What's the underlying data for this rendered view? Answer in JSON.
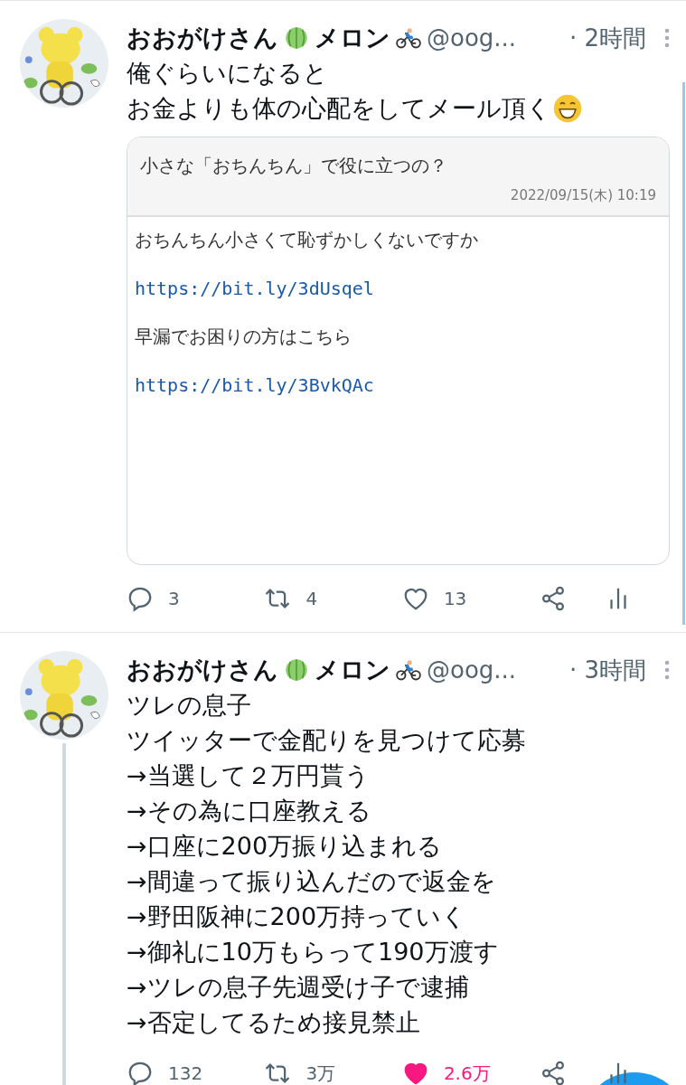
{
  "tweets": [
    {
      "name": [
        "おおがけさん",
        "メロン"
      ],
      "handle": "@oog...",
      "time": "· 2時間",
      "thread": false,
      "body": [
        {
          "kind": "plain",
          "text": "俺ぐらいになると"
        },
        {
          "kind": "grin",
          "text": "お金よりも体の心配をしてメール頂く"
        }
      ],
      "card": {
        "title": "小さな「おちんちん」で役に立つの？",
        "date": "2022/09/15(木) 10:19",
        "lines": [
          {
            "kind": "text",
            "text": "おちんちん小さくて恥ずかしくないですか"
          },
          {
            "kind": "link",
            "text": "https://bit.ly/3dUsqel"
          },
          {
            "kind": "text",
            "text": "早漏でお困りの方はこちら"
          },
          {
            "kind": "link",
            "text": "https://bit.ly/3BvkQAc"
          }
        ]
      },
      "replies": "3",
      "retweets": "4",
      "likes": "13",
      "liked": false
    },
    {
      "name": [
        "おおがけさん",
        "メロン"
      ],
      "handle": "@oog...",
      "time": "· 3時間",
      "thread": true,
      "body": [
        {
          "text": "ツレの息子"
        },
        {
          "text": "ツイッターで金配りを見つけて応募"
        },
        {
          "text": "→当選して２万円貰う"
        },
        {
          "text": "→その為に口座教える"
        },
        {
          "text": "→口座に200万振り込まれる"
        },
        {
          "text": "→間違って振り込んだので返金を"
        },
        {
          "text": "→野田阪神に200万持っていく"
        },
        {
          "text": "→御礼に10万もらって190万渡す"
        },
        {
          "text": "→ツレの息子先週受け子で逮捕"
        },
        {
          "text": "→否定してるため接見禁止"
        }
      ],
      "replies": "132",
      "retweets": "3万",
      "likes": "2.6万",
      "liked": true
    }
  ]
}
